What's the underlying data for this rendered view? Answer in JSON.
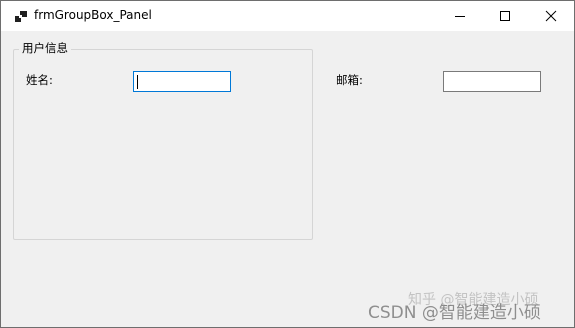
{
  "window": {
    "title": "frmGroupBox_Panel",
    "controls": [
      "minimize-icon",
      "maximize-icon",
      "close-icon"
    ]
  },
  "groupbox": {
    "title": "用户信息"
  },
  "form": {
    "name_label": "姓名:",
    "name_value": "",
    "email_label": "邮箱:",
    "email_value": ""
  },
  "watermarks": {
    "zhihu": "知乎 @智能建造小硕",
    "csdn": "CSDN @智能建造小硕"
  },
  "colors": {
    "focus_border": "#0078d7",
    "window_bg": "#f0f0f0",
    "titlebar_bg": "#ffffff"
  }
}
